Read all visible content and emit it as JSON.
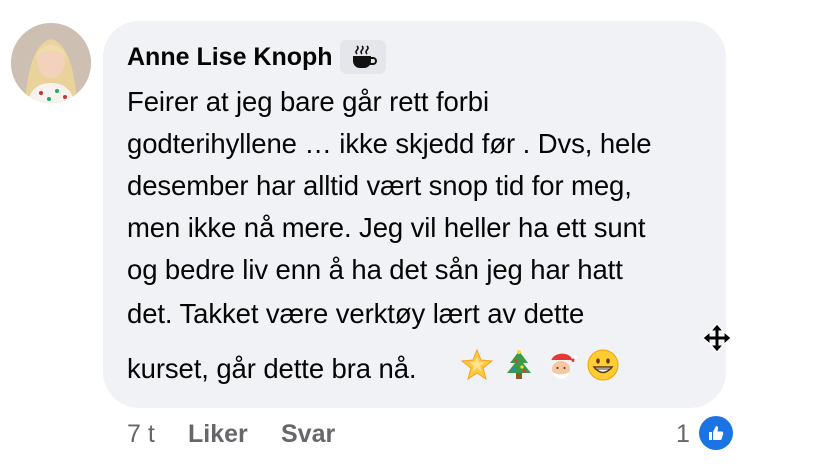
{
  "comment": {
    "author": "Anne Lise Knoph",
    "badge_icon": "coffee-cup-icon",
    "lines": [
      "Feirer at jeg bare går rett forbi",
      "godterihyllene … ikke skjedd før . Dvs, hele",
      "desember har alltid vært snop tid for meg,",
      "men ikke nå mere. Jeg vil heller ha ett sunt",
      "og bedre liv enn å ha det sån jeg har hatt",
      "det. Takket være verktøy lært av dette",
      "kurset, går dette bra nå."
    ],
    "emojis": [
      "glowing-star-emoji",
      "christmas-tree-emoji",
      "santa-emoji",
      "grinning-face-emoji"
    ]
  },
  "footer": {
    "time": "7 t",
    "like_label": "Liker",
    "reply_label": "Svar",
    "like_count": "1"
  },
  "colors": {
    "bubble": "#f0f2f5",
    "text": "#050505",
    "muted": "#65676b",
    "like_blue": "#1b74e4"
  }
}
